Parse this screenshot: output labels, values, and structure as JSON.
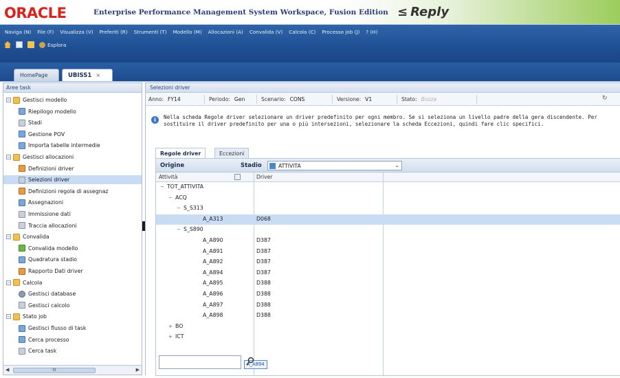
{
  "header": {
    "logo": "ORACLE",
    "title": "Enterprise Performance Management System Workspace, Fusion Edition",
    "partner": "Reply"
  },
  "menu": [
    "Naviga (N)",
    "File (F)",
    "Visualizza (V)",
    "Preferiti (R)",
    "Strumenti (T)",
    "Modello (M)",
    "Allocazioni (A)",
    "Convalida (V)",
    "Calcola (C)",
    "Processo job (J)",
    "? (H)"
  ],
  "toolbar": {
    "explore": "Esplora"
  },
  "tabs": [
    {
      "label": "HomePage"
    },
    {
      "label": "UBISS1",
      "close": "×"
    }
  ],
  "left": {
    "title": "Aree task",
    "tree": [
      {
        "label": "Gestisci modello",
        "level": 0,
        "icon": "folder-icon",
        "expander": "−"
      },
      {
        "label": "Riepilogo modello",
        "level": 1,
        "icon": "summary-icon"
      },
      {
        "label": "Stadi",
        "level": 1,
        "icon": "stages-icon"
      },
      {
        "label": "Gestione POV",
        "level": 1,
        "icon": "pov-icon"
      },
      {
        "label": "Importa tabelle intermedie",
        "level": 1,
        "icon": "import-icon"
      },
      {
        "label": "Gestisci allocazioni",
        "level": 0,
        "icon": "folder-icon",
        "expander": "−"
      },
      {
        "label": "Definizioni driver",
        "level": 1,
        "icon": "driver-definition-icon"
      },
      {
        "label": "Selezioni driver",
        "level": 1,
        "icon": "driver-selection-icon",
        "selected": true
      },
      {
        "label": "Definizioni regola di assegnaz",
        "level": 1,
        "icon": "rule-definition-icon"
      },
      {
        "label": "Assegnazioni",
        "level": 1,
        "icon": "assignments-icon"
      },
      {
        "label": "Immissione dati",
        "level": 1,
        "icon": "data-entry-icon"
      },
      {
        "label": "Traccia allocazioni",
        "level": 1,
        "icon": "trace-icon"
      },
      {
        "label": "Convalida",
        "level": 0,
        "icon": "folder-icon",
        "expander": "−"
      },
      {
        "label": "Convalida modello",
        "level": 1,
        "icon": "validate-model-icon"
      },
      {
        "label": "Quadratura stadio",
        "level": 1,
        "icon": "stage-balance-icon"
      },
      {
        "label": "Rapporto Dati driver",
        "level": 1,
        "icon": "driver-report-icon"
      },
      {
        "label": "Calcola",
        "level": 0,
        "icon": "folder-icon",
        "expander": "−"
      },
      {
        "label": "Gestisci database",
        "level": 1,
        "icon": "database-icon"
      },
      {
        "label": "Gestisci calcolo",
        "level": 1,
        "icon": "calculation-icon"
      },
      {
        "label": "Stato job",
        "level": 0,
        "icon": "folder-icon",
        "expander": "−"
      },
      {
        "label": "Gestisci flusso di task",
        "level": 1,
        "icon": "task-flow-icon"
      },
      {
        "label": "Cerca processo",
        "level": 1,
        "icon": "search-process-icon"
      },
      {
        "label": "Cerca task",
        "level": 1,
        "icon": "search-task-icon"
      }
    ],
    "scroll_thumb": "III"
  },
  "main": {
    "title": "Selezioni driver",
    "pov": [
      {
        "label": "Anno:",
        "value": "FY14"
      },
      {
        "label": "Periodo:",
        "value": "Gen"
      },
      {
        "label": "Scenario:",
        "value": "CONS"
      },
      {
        "label": "Versione:",
        "value": "V1"
      },
      {
        "label": "Stato:",
        "value": "Bozza",
        "disabled": true
      }
    ],
    "info": "Nella scheda Regole driver selezionare un driver predefinito per ogni membro. Se si seleziona un livello padre della gera discendente. Per sostituire il driver predefinito per una o più intersezioni, selezionare la scheda Eccezioni, quindi fare clic specifici.",
    "inner_tabs": [
      "Regole driver",
      "Eccezioni"
    ],
    "origin_label": "Origine",
    "stage_label": "Stadio",
    "stage_value": "ATTIVITA",
    "columns": [
      "Attività",
      "Driver"
    ],
    "rows": [
      {
        "member": "TOT_ATTIVITA",
        "indent": 0,
        "expander": "−",
        "driver": ""
      },
      {
        "member": "ACQ",
        "indent": 1,
        "expander": "−",
        "driver": ""
      },
      {
        "member": "S_S313",
        "indent": 2,
        "expander": "−",
        "driver": ""
      },
      {
        "member": "A_A313",
        "indent": 3,
        "driver": "D068",
        "selected": true
      },
      {
        "member": "S_S890",
        "indent": 2,
        "expander": "−",
        "driver": ""
      },
      {
        "member": "A_A890",
        "indent": 3,
        "driver": "D387"
      },
      {
        "member": "A_A891",
        "indent": 3,
        "driver": "D387"
      },
      {
        "member": "A_A892",
        "indent": 3,
        "driver": "D387"
      },
      {
        "member": "A_A894",
        "indent": 3,
        "driver": "D387"
      },
      {
        "member": "A_A895",
        "indent": 3,
        "driver": "D388"
      },
      {
        "member": "A_A896",
        "indent": 3,
        "driver": "D388"
      },
      {
        "member": "A_A897",
        "indent": 3,
        "driver": "D388"
      },
      {
        "member": "A_A898",
        "indent": 3,
        "driver": "D388"
      },
      {
        "member": "BO",
        "indent": 1,
        "expander": "+",
        "driver": ""
      },
      {
        "member": "ICT",
        "indent": 1,
        "expander": "+",
        "driver": ""
      }
    ],
    "tooltip": "A_A894",
    "search_value": ""
  },
  "colors": {
    "oracle_red": "#d8241c",
    "menubar_blue": "#1f4f94",
    "selection": "#c9dcf3"
  }
}
